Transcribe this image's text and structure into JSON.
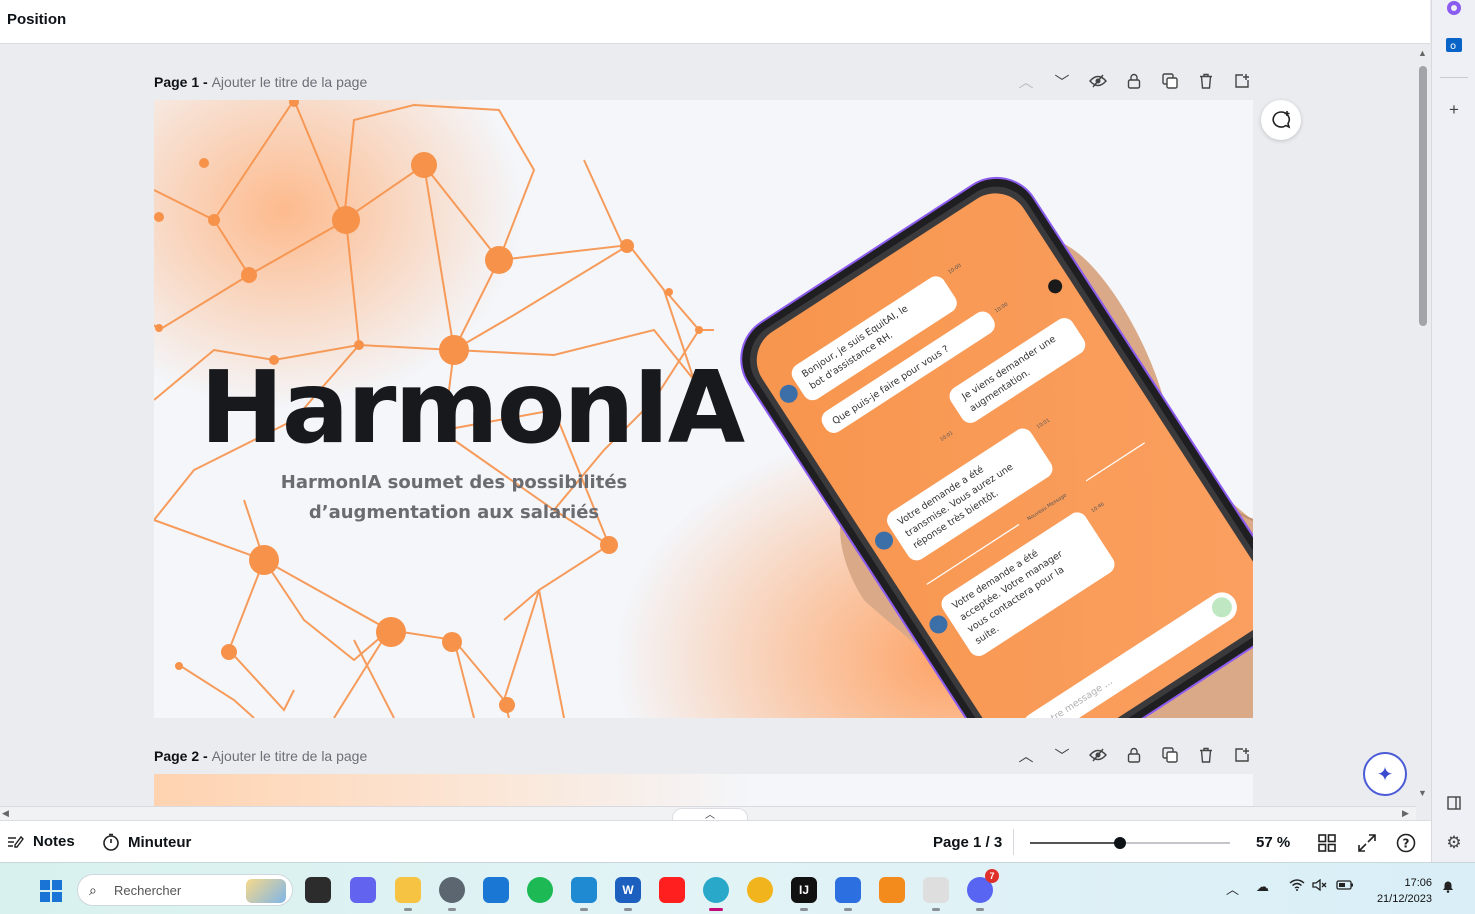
{
  "topbar": {
    "title": "Position"
  },
  "pages": [
    {
      "label": "Page 1",
      "separator": " - ",
      "subtitle": "Ajouter le titre de la page"
    },
    {
      "label": "Page 2",
      "separator": " - ",
      "subtitle": "Ajouter le titre de la page"
    }
  ],
  "slide": {
    "brand": "HarmonIA",
    "tagline_1": "HarmonIA soumet des possibilités",
    "tagline_2": "d’augmentation aux salariés",
    "accent_color": "#f7924a"
  },
  "chat": {
    "bot_1a": "Bonjour, je suis EquitAI, le",
    "bot_1b": "bot d'assistance RH.",
    "bot_2": "Que puis-je faire pour vous ?",
    "user_1a": "Je viens demander une",
    "user_1b": "augmentation.",
    "bot_3a": "Votre demande a été",
    "bot_3b": "transmise. Vous aurez une",
    "bot_3c": "réponse très bientôt.",
    "new_message": "Nouveau Message",
    "bot_4a": "Votre demande a été",
    "bot_4b": "acceptée. Votre manager",
    "bot_4c": "vous contactera pour la",
    "bot_4d": "suite.",
    "input_placeholder": "Votre message ...",
    "time_1": "10:00",
    "time_2": "10:00",
    "time_3": "10:01",
    "time_4": "10:01",
    "time_5": "10:46"
  },
  "bottombar": {
    "notes": "Notes",
    "timer": "Minuteur",
    "page_indicator": "Page 1 / 3",
    "zoom": "57 %",
    "zoom_fraction": 0.45
  },
  "taskbar": {
    "search_placeholder": "Rechercher",
    "time": "17:06",
    "date": "21/12/2023",
    "discord_badge": "7",
    "word_label": "W",
    "jb_label": "IJ"
  }
}
